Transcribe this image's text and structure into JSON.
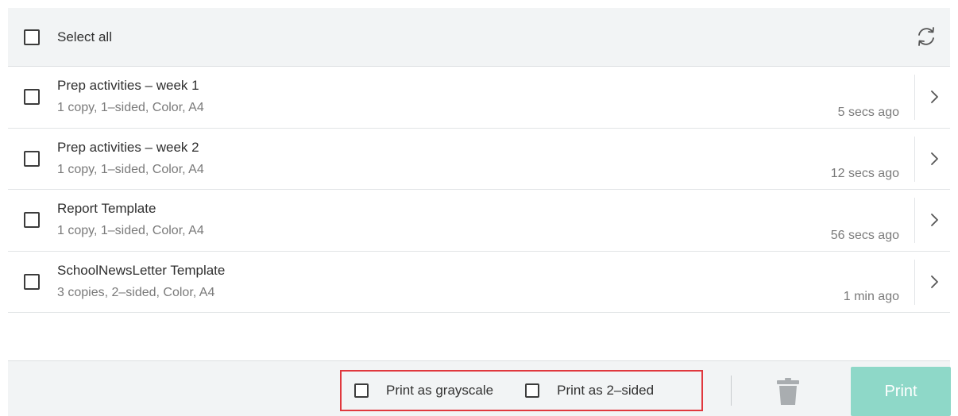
{
  "header": {
    "select_all_label": "Select all",
    "refresh_icon": "refresh-icon"
  },
  "jobs": [
    {
      "title": "Prep activities – week 1",
      "details": "1 copy, 1–sided, Color, A4",
      "time": "5 secs ago"
    },
    {
      "title": "Prep activities – week 2",
      "details": "1 copy, 1–sided, Color, A4",
      "time": "12 secs ago"
    },
    {
      "title": "Report Template",
      "details": "1 copy, 1–sided, Color, A4",
      "time": "56 secs ago"
    },
    {
      "title": "SchoolNewsLetter Template",
      "details": "3 copies, 2–sided, Color, A4",
      "time": "1 min ago"
    }
  ],
  "footer": {
    "grayscale_label": "Print as grayscale",
    "duplex_label": "Print as 2–sided",
    "delete_icon": "trash-icon",
    "print_label": "Print"
  },
  "colors": {
    "header_bg": "#f2f4f5",
    "print_button_bg": "#8ed8c8",
    "highlight_border": "#e0383e"
  }
}
